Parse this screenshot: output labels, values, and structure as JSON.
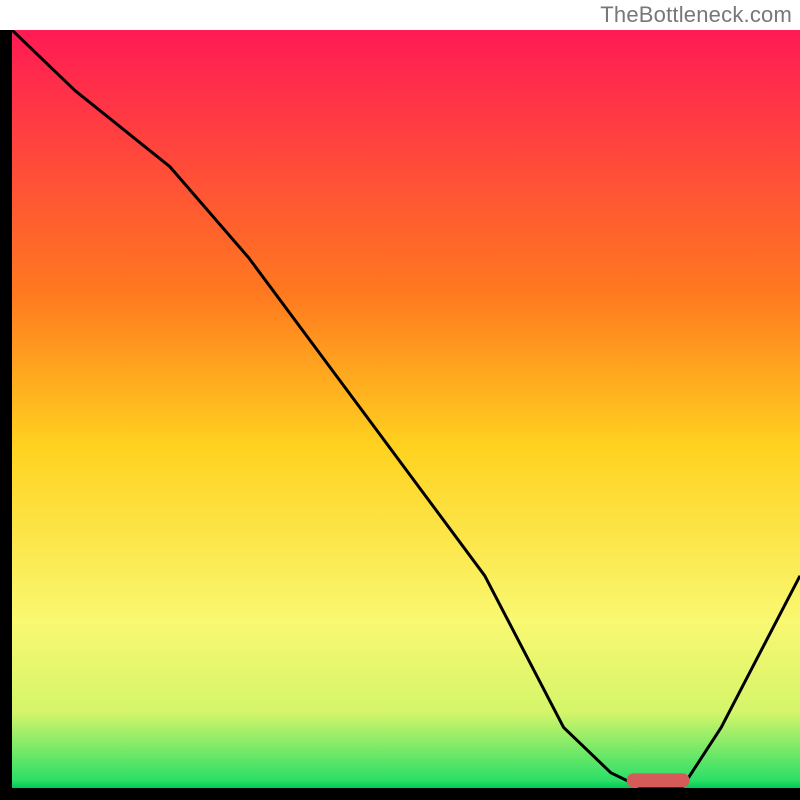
{
  "watermark": "TheBottleneck.com",
  "chart_data": {
    "type": "line",
    "title": "",
    "xlabel": "",
    "ylabel": "",
    "xlim": [
      0,
      100
    ],
    "ylim": [
      0,
      100
    ],
    "x": [
      0,
      8,
      20,
      30,
      40,
      50,
      60,
      65,
      70,
      76,
      80,
      85,
      90,
      95,
      100
    ],
    "values": [
      100,
      92,
      82,
      70,
      56,
      42,
      28,
      18,
      8,
      2,
      0,
      0,
      8,
      18,
      28
    ],
    "marker": {
      "x_start": 78,
      "x_end": 86,
      "y": 1
    },
    "gradient_stops": [
      {
        "offset": 0,
        "color": "#ff1a55"
      },
      {
        "offset": 35,
        "color": "#ff7a1f"
      },
      {
        "offset": 55,
        "color": "#ffd21f"
      },
      {
        "offset": 78,
        "color": "#f9f871"
      },
      {
        "offset": 90,
        "color": "#d4f56a"
      },
      {
        "offset": 99,
        "color": "#2bdf67"
      },
      {
        "offset": 100,
        "color": "#00c853"
      }
    ],
    "axis_color": "#000000",
    "line_color": "#000000",
    "marker_color": "#d55a5a"
  }
}
